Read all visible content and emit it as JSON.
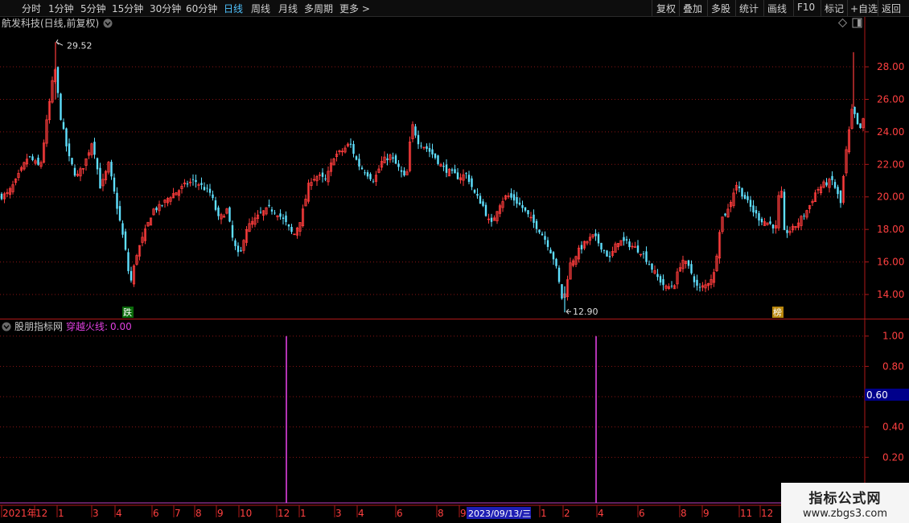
{
  "toolbar": {
    "periods": [
      "分时",
      "1分钟",
      "5分钟",
      "15分钟",
      "30分钟",
      "60分钟",
      "日线",
      "周线",
      "月线",
      "多周期",
      "更多 >"
    ],
    "active_period": "日线",
    "actions": [
      "复权",
      "叠加",
      "多股",
      "统计",
      "画线",
      "F10",
      "标记",
      "+自选",
      "返回"
    ]
  },
  "main": {
    "title": "航发科技(日线,前复权)",
    "high_label": "29.52",
    "low_label": "12.90",
    "marker_left": "跌",
    "marker_right": "榜"
  },
  "indicator": {
    "name": "股朋指标网",
    "line_name": "穿越火线:",
    "line_value": "0.00",
    "cursor_value": "0.60"
  },
  "date_axis": {
    "labels": [
      "2021年",
      "12",
      "1",
      "3",
      "4",
      "6",
      "7",
      "8",
      "9",
      "10",
      "12",
      "1",
      "3",
      "4",
      "6",
      "8",
      "9",
      "1",
      "2",
      "4",
      "6",
      "8",
      "9",
      "11",
      "12"
    ],
    "highlight": "2023/09/13/三"
  },
  "watermark": {
    "line1": "指标公式网",
    "line2": "www.zbgs3.com"
  },
  "chart_data": [
    {
      "type": "candlestick",
      "title": "航发科技(日线,前复权)",
      "y_ticks": [
        14.0,
        16.0,
        18.0,
        20.0,
        22.0,
        24.0,
        26.0,
        28.0
      ],
      "ylim": [
        12.5,
        29.9
      ],
      "grid": true,
      "x_tick_labels": [
        "2021年",
        "12",
        "1",
        "3",
        "4",
        "6",
        "7",
        "8",
        "9",
        "10",
        "12",
        "1",
        "3",
        "4",
        "6",
        "8",
        "9",
        "1",
        "2",
        "4",
        "6",
        "8",
        "9",
        "11",
        "12"
      ],
      "annotations": [
        {
          "text": "29.52",
          "value": 29.52
        },
        {
          "text": "12.90",
          "value": 12.9
        }
      ],
      "close_path": [
        [
          0,
          20.0
        ],
        [
          10,
          20.2
        ],
        [
          20,
          21.0
        ],
        [
          35,
          22.5
        ],
        [
          50,
          21.8
        ],
        [
          62,
          26.0
        ],
        [
          68,
          28.0
        ],
        [
          75,
          25.0
        ],
        [
          85,
          22.5
        ],
        [
          95,
          21.2
        ],
        [
          105,
          22.0
        ],
        [
          115,
          23.5
        ],
        [
          125,
          20.5
        ],
        [
          135,
          22.0
        ],
        [
          145,
          19.5
        ],
        [
          155,
          17.0
        ],
        [
          162,
          14.6
        ],
        [
          170,
          16.5
        ],
        [
          180,
          17.8
        ],
        [
          190,
          19.2
        ],
        [
          200,
          19.4
        ],
        [
          210,
          20.0
        ],
        [
          222,
          20.4
        ],
        [
          232,
          20.8
        ],
        [
          242,
          21.0
        ],
        [
          252,
          20.6
        ],
        [
          262,
          20.2
        ],
        [
          272,
          18.6
        ],
        [
          282,
          19.2
        ],
        [
          290,
          17.2
        ],
        [
          298,
          16.2
        ],
        [
          305,
          18.0
        ],
        [
          315,
          18.5
        ],
        [
          325,
          19.0
        ],
        [
          335,
          19.3
        ],
        [
          345,
          19.0
        ],
        [
          355,
          18.4
        ],
        [
          365,
          17.6
        ],
        [
          375,
          18.8
        ],
        [
          385,
          21.0
        ],
        [
          395,
          21.3
        ],
        [
          405,
          21.0
        ],
        [
          415,
          22.5
        ],
        [
          425,
          22.8
        ],
        [
          435,
          23.3
        ],
        [
          445,
          22.0
        ],
        [
          455,
          21.5
        ],
        [
          465,
          21.0
        ],
        [
          475,
          22.2
        ],
        [
          485,
          22.5
        ],
        [
          495,
          21.8
        ],
        [
          505,
          21.0
        ],
        [
          512,
          24.5
        ],
        [
          520,
          23.4
        ],
        [
          530,
          23.0
        ],
        [
          540,
          22.5
        ],
        [
          550,
          21.8
        ],
        [
          560,
          21.5
        ],
        [
          570,
          21.2
        ],
        [
          580,
          21.4
        ],
        [
          590,
          20.2
        ],
        [
          600,
          19.5
        ],
        [
          610,
          18.2
        ],
        [
          620,
          19.5
        ],
        [
          630,
          20.1
        ],
        [
          640,
          19.8
        ],
        [
          650,
          19.3
        ],
        [
          660,
          18.6
        ],
        [
          670,
          18.0
        ],
        [
          680,
          17.2
        ],
        [
          690,
          16.0
        ],
        [
          700,
          13.4
        ],
        [
          708,
          15.8
        ],
        [
          718,
          16.6
        ],
        [
          728,
          17.2
        ],
        [
          738,
          17.6
        ],
        [
          748,
          16.9
        ],
        [
          758,
          16.2
        ],
        [
          768,
          17.3
        ],
        [
          778,
          17.2
        ],
        [
          788,
          16.9
        ],
        [
          798,
          16.6
        ],
        [
          808,
          15.8
        ],
        [
          818,
          15.0
        ],
        [
          828,
          14.4
        ],
        [
          838,
          14.6
        ],
        [
          848,
          16.2
        ],
        [
          858,
          15.5
        ],
        [
          868,
          14.3
        ],
        [
          878,
          14.6
        ],
        [
          888,
          15.3
        ],
        [
          896,
          18.6
        ],
        [
          905,
          19.2
        ],
        [
          915,
          20.8
        ],
        [
          925,
          20.0
        ],
        [
          935,
          19.2
        ],
        [
          945,
          18.6
        ],
        [
          955,
          18.4
        ],
        [
          965,
          18.1
        ],
        [
          970,
          21.2
        ],
        [
          975,
          17.8
        ],
        [
          985,
          18.0
        ],
        [
          995,
          18.6
        ],
        [
          1005,
          19.3
        ],
        [
          1015,
          20.4
        ],
        [
          1025,
          20.8
        ],
        [
          1035,
          21.0
        ],
        [
          1045,
          19.6
        ],
        [
          1052,
          22.8
        ],
        [
          1060,
          25.6
        ],
        [
          1065,
          24.4
        ],
        [
          1070,
          24.2
        ],
        [
          1075,
          25.0
        ]
      ]
    },
    {
      "type": "line",
      "series": [
        {
          "name": "穿越火线",
          "x_positions": [
            356,
            741
          ],
          "values": [
            1.0,
            1.0
          ],
          "baseline": 0.0
        }
      ],
      "y_ticks": [
        0.2,
        0.4,
        0.6,
        0.8,
        1.0
      ],
      "ylim": [
        -0.05,
        1.08
      ],
      "grid": true
    }
  ]
}
